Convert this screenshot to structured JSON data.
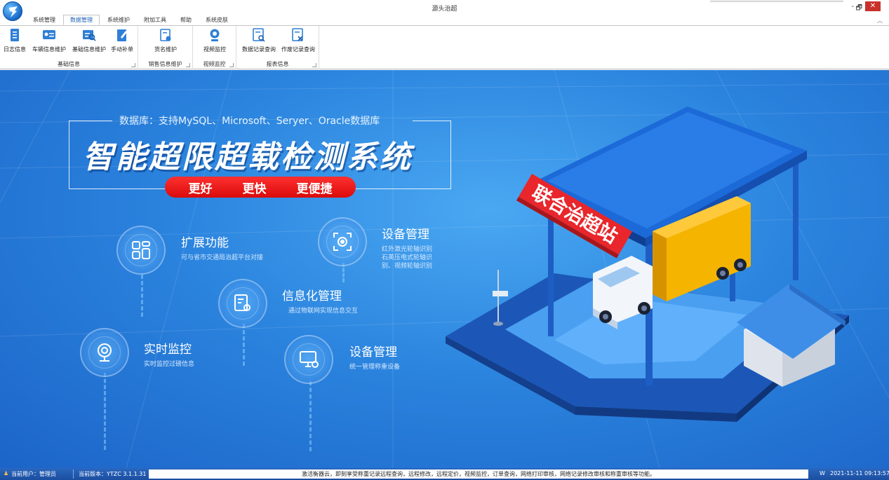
{
  "window": {
    "title": "源头治超",
    "minimize": "-",
    "restore": "🗗",
    "close": "✕"
  },
  "tabs": [
    {
      "label": "系统管理"
    },
    {
      "label": "数据管理"
    },
    {
      "label": "系统维护"
    },
    {
      "label": "附加工具"
    },
    {
      "label": "帮助"
    },
    {
      "label": "系统皮肤"
    }
  ],
  "ribbon": {
    "groups": [
      {
        "label": "基础信息"
      },
      {
        "label": "销售信息维护"
      },
      {
        "label": "视频监控"
      },
      {
        "label": "报表信息"
      }
    ],
    "buttons": [
      {
        "label": "日志信息",
        "icon": "log-icon"
      },
      {
        "label": "车辆信息维护",
        "icon": "vehicle-card-icon"
      },
      {
        "label": "基础信息维护",
        "icon": "base-info-icon"
      },
      {
        "label": "手动补单",
        "icon": "edit-doc-icon"
      },
      {
        "label": "货名维护",
        "icon": "goods-icon"
      },
      {
        "label": "视频监控",
        "icon": "camera-icon"
      },
      {
        "label": "数据记录查询",
        "icon": "record-search-icon"
      },
      {
        "label": "作废记录查询",
        "icon": "void-record-icon"
      }
    ]
  },
  "banner": {
    "db_line": "数据库：支持MySQL、Microsoft、Seryer、Oracle数据库",
    "title": "智能超限超载检测系统",
    "slogans": [
      "更好",
      "更快",
      "更便捷"
    ],
    "station_sign": "联合治超站",
    "features": [
      {
        "title": "扩展功能",
        "desc": "可与省市交通局治超平台对接",
        "icon": "grid-apps-icon"
      },
      {
        "title": "设备管理",
        "desc": "红外激光轮轴识别\n石英压电式轮轴识\n别、视频轮轴识别",
        "icon": "scan-target-icon"
      },
      {
        "title": "信息化管理",
        "desc": "通过物联网实现信息交互",
        "icon": "doc-gear-icon"
      },
      {
        "title": "实时监控",
        "desc": "实时监控过磅信息",
        "icon": "webcam-icon"
      },
      {
        "title": "设备管理",
        "desc": "统一管理称重设备",
        "icon": "monitor-gear-icon"
      }
    ]
  },
  "status": {
    "user": "当前用户：管理员",
    "version": "当前版本：YTZC 3.1.1.31",
    "message": "激活衡器云，即刻享受称重记录远程查询，远程修改，远程定价，视频监控，订单查询，网络打印审核，网络记录修改审核和称重审核等功能。",
    "mode": "W",
    "datetime": "2021-11-11 09:13:57"
  }
}
